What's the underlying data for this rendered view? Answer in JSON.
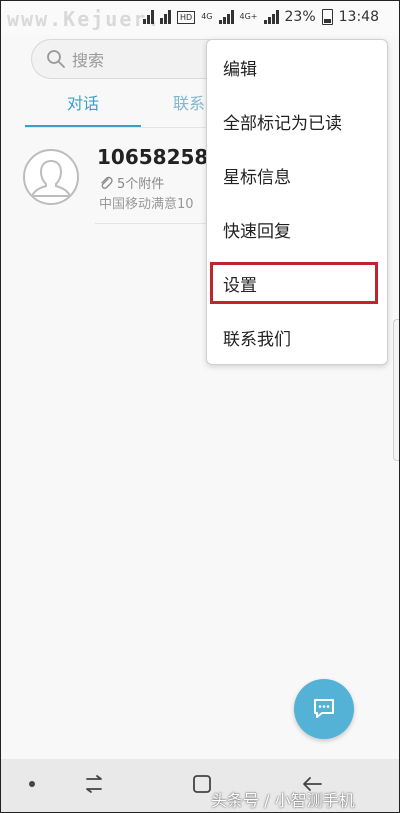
{
  "status_bar": {
    "watermark": "www.Kejuer.",
    "battery": "23%",
    "time": "13:48",
    "hd": "HD",
    "net1": "4G",
    "net2": "4G+"
  },
  "search": {
    "placeholder": "搜索"
  },
  "tabs": [
    {
      "label": "对话"
    },
    {
      "label": "联系"
    }
  ],
  "conversation": {
    "title": "10658258",
    "attachments": "5个附件",
    "preview": "中国移动满意10"
  },
  "menu": {
    "items": [
      {
        "label": "编辑"
      },
      {
        "label": "全部标记为已读"
      },
      {
        "label": "星标信息"
      },
      {
        "label": "快速回复"
      },
      {
        "label": "设置"
      },
      {
        "label": "联系我们"
      }
    ],
    "highlight_color": "#c0252e"
  },
  "accent_color": "#3aa0c8",
  "fab_color": "#53b2d6",
  "watermark_bottom": "头条号 / 小智测手机"
}
